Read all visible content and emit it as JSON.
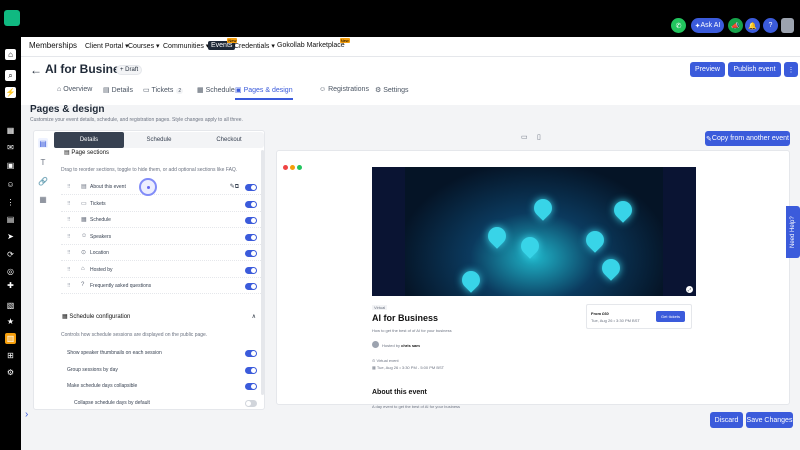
{
  "topbar": {
    "ask_ai": "Ask AI",
    "colors": {
      "call": "#22c55e",
      "ask_ai": "#3b5bdb",
      "megaphone": "#16a34a",
      "bell": "#3b5bdb",
      "help": "#3b5bdb"
    }
  },
  "rail_icons": [
    "home-icon",
    "search-icon",
    "bolt-icon",
    "dashboard-icon",
    "chat-icon",
    "calendar-icon",
    "contacts-icon",
    "opportunities-icon",
    "payments-icon",
    "marketing-icon",
    "automation-icon",
    "sites-icon",
    "memberships-icon",
    "media-icon",
    "reputation-icon",
    "reporting-icon",
    "apps-icon",
    "settings-icon"
  ],
  "nav": {
    "brand": "Memberships",
    "items": [
      {
        "label": "Client Portal",
        "has_dropdown": true
      },
      {
        "label": "Courses",
        "has_dropdown": true
      },
      {
        "label": "Communities",
        "has_dropdown": true
      },
      {
        "label": "Events",
        "active": true,
        "badge": "New"
      },
      {
        "label": "Credentials",
        "has_dropdown": true
      },
      {
        "label": "Gokollab Marketplace",
        "badge": "New"
      }
    ]
  },
  "header": {
    "title": "AI for Business",
    "status": "Draft",
    "preview_label": "Preview",
    "publish_label": "Publish event",
    "more_label": "⋮"
  },
  "tabs": [
    {
      "label": "Overview",
      "icon": "home-icon"
    },
    {
      "label": "Details",
      "icon": "document-icon"
    },
    {
      "label": "Tickets",
      "icon": "ticket-icon",
      "count": "2"
    },
    {
      "label": "Schedule",
      "icon": "calendar-icon"
    },
    {
      "label": "Pages & design",
      "icon": "layout-icon",
      "active": true
    },
    {
      "label": "Registrations",
      "icon": "users-icon"
    },
    {
      "label": "Settings",
      "icon": "gear-icon"
    }
  ],
  "page": {
    "title": "Pages & design",
    "subtitle": "Customize your event details, schedule, and registration pages. Style changes apply to all three."
  },
  "editor": {
    "segments": [
      "Details",
      "Schedule",
      "Checkout"
    ],
    "active_segment": "Details",
    "sections_heading": "Page sections",
    "sections_help": "Drag to reorder sections, toggle to hide them, or add optional sections like FAQ.",
    "sections": [
      {
        "label": "About this event",
        "icon": "document-icon",
        "enabled": true
      },
      {
        "label": "Tickets",
        "icon": "ticket-icon",
        "enabled": true
      },
      {
        "label": "Schedule",
        "icon": "calendar-icon",
        "enabled": true
      },
      {
        "label": "Speakers",
        "icon": "users-icon",
        "enabled": true
      },
      {
        "label": "Location",
        "icon": "location-icon",
        "enabled": true
      },
      {
        "label": "Hosted by",
        "icon": "host-icon",
        "enabled": true
      },
      {
        "label": "Frequently asked questions",
        "icon": "help-icon",
        "enabled": true
      }
    ],
    "schedule_heading": "Schedule configuration",
    "schedule_help": "Controls how schedule sessions are displayed on the public page.",
    "schedule_options": [
      {
        "label": "Show speaker thumbnails on each session",
        "enabled": true
      },
      {
        "label": "Group sessions by day",
        "enabled": true
      },
      {
        "label": "Make schedule days collapsible",
        "enabled": true
      },
      {
        "label": "Collapse schedule days by default",
        "enabled": false
      }
    ]
  },
  "preview": {
    "copy_label": "Copy from another event",
    "event_kind": "Virtual",
    "event_title": "AI for Business",
    "event_tagline": "How to get the best of of AI for your business",
    "hosted_by": "Hosted by",
    "host_name": "chris sam",
    "location": "Virtual event",
    "datetime": "Tue, Aug 26 • 3:30 PM - 5:00 PM BST",
    "price": "From £60",
    "price_date": "Tue, Aug 26 • 3:30 PM BST",
    "get_tickets": "Get tickets",
    "about_heading": "About this event",
    "about_text": "A day event to get the best of AI for your business"
  },
  "footer": {
    "discard_label": "Discard",
    "save_label": "Save Changes",
    "need_help": "Need Help?"
  }
}
